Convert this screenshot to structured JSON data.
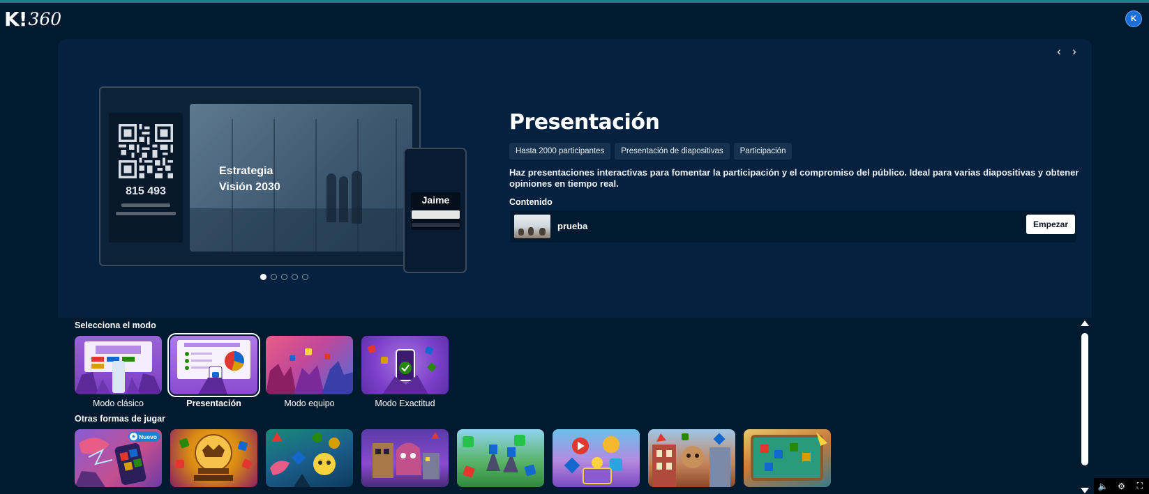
{
  "app": {
    "logo_k": "K!",
    "logo_360": "360",
    "avatar_initial": "K"
  },
  "hero": {
    "nav_prev": "‹",
    "nav_next": "›",
    "illustration": {
      "pin": "815 493",
      "slide_title_line1": "Estrategia",
      "slide_title_line2": "Visión 2030",
      "phone_name": "Jaime"
    },
    "carousel_dots": {
      "count": 5,
      "active": 1
    },
    "title": "Presentación",
    "tags": [
      "Hasta 2000 participantes",
      "Presentación de diapositivas",
      "Participación"
    ],
    "description": "Haz presentaciones interactivas para fomentar la participación y el compromiso del público. Ideal para varias diapositivas y obtener opiniones en tiempo real.",
    "content_label": "Contenido",
    "content_item": "prueba",
    "start_button": "Empezar"
  },
  "modes": {
    "label": "Selecciona el modo",
    "items": [
      {
        "label": "Modo clásico",
        "selected": false
      },
      {
        "label": "Presentación",
        "selected": true
      },
      {
        "label": "Modo equipo",
        "selected": false
      },
      {
        "label": "Modo Exactitud",
        "selected": false
      }
    ]
  },
  "other_games": {
    "label": "Otras formas de jugar",
    "new_badge": "Nuevo"
  },
  "colors": {
    "background": "#021a30",
    "panel": "#04223f",
    "accent_top": "#1a7f8c",
    "badge_blue": "#1d7fd6"
  }
}
